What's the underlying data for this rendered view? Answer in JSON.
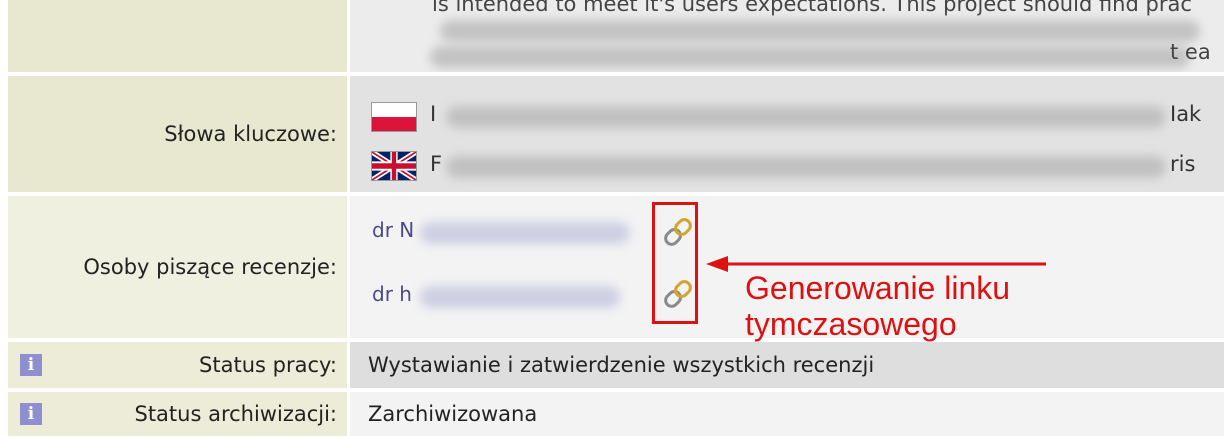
{
  "description": {
    "line1_fragment": "is intended to meet it's users expectations. This project should find prac",
    "line2_end": "t ea"
  },
  "keywords": {
    "label": "Słowa kluczowe:",
    "pl_start": "I",
    "pl_end": "Iak",
    "en_start": "F",
    "en_end": "ris"
  },
  "reviewers": {
    "label": "Osoby piszące recenzje:",
    "items": [
      {
        "name": "dr N"
      },
      {
        "name": "dr h"
      }
    ]
  },
  "annotation": {
    "line1": "Generowanie linku",
    "line2": "tymczasowego",
    "color": "#dd1111"
  },
  "status": {
    "label": "Status pracy:",
    "value": "Wystawianie i zatwierdzenie wszystkich recenzji",
    "icon": "info-icon",
    "icon_letter": "i"
  },
  "archive": {
    "label": "Status archiwizacji:",
    "value": "Zarchiwizowana",
    "icon": "info-icon",
    "icon_letter": "i"
  }
}
